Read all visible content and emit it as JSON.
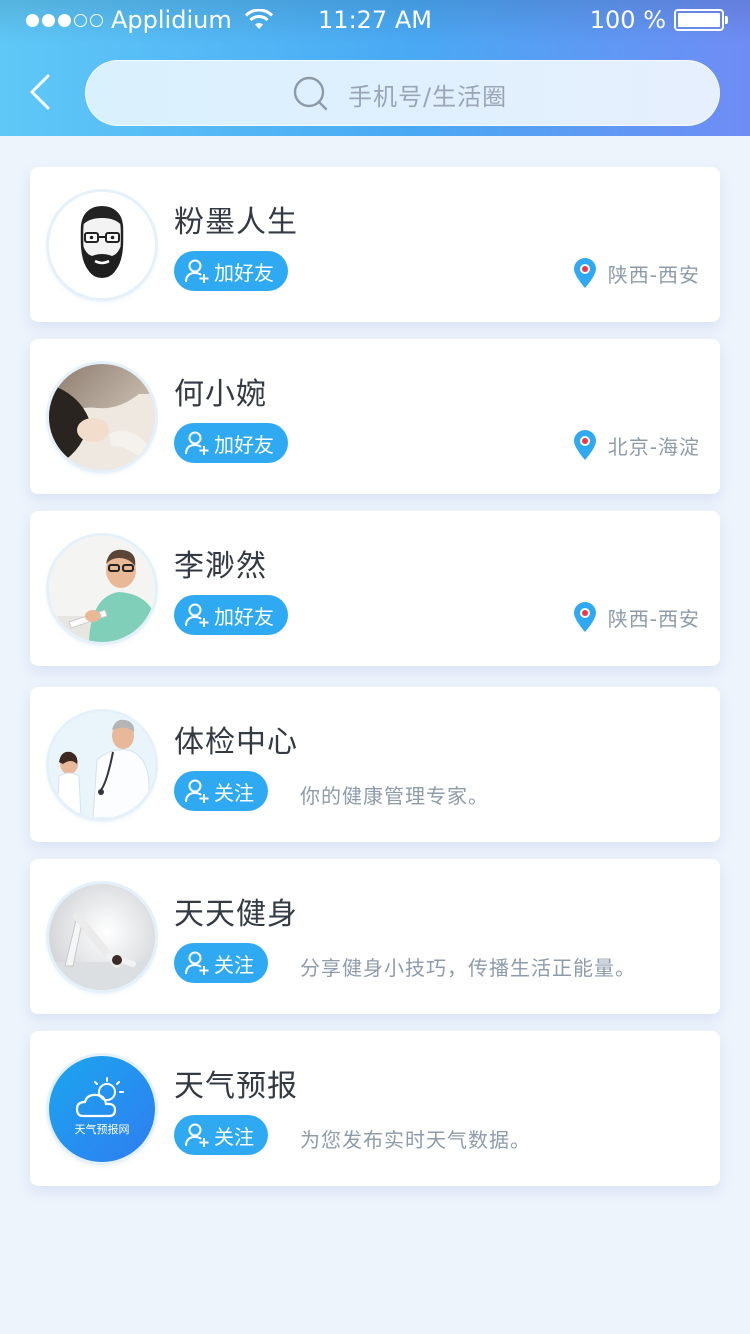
{
  "status_bar": {
    "carrier": "Applidium",
    "time": "11:27 AM",
    "battery": "100 %"
  },
  "search": {
    "placeholder": "手机号/生活圈"
  },
  "colors": {
    "accent": "#2fa9f2",
    "header_start": "#5fc8f7",
    "header_end": "#6f8cf5",
    "pin": "#2fa9f2",
    "pin_dot": "#f0364a"
  },
  "items": [
    {
      "name": "粉墨人生",
      "button": "加好友",
      "location": "陕西-西安",
      "avatar_icon": "bearded-man-avatar-icon"
    },
    {
      "name": "何小婉",
      "button": "加好友",
      "location": "北京-海淀",
      "avatar_icon": "woman-photo-avatar"
    },
    {
      "name": "李渺然",
      "button": "加好友",
      "location": "陕西-西安",
      "avatar_icon": "man-glasses-photo-avatar"
    },
    {
      "name": "体检中心",
      "button": "关注",
      "desc": "你的健康管理专家。",
      "avatar_icon": "doctor-photo-avatar"
    },
    {
      "name": "天天健身",
      "button": "关注",
      "desc": "分享健身小技巧，传播生活正能量。",
      "avatar_icon": "yoga-photo-avatar"
    },
    {
      "name": "天气预报",
      "button": "关注",
      "desc": "为您发布实时天气数据。",
      "avatar_icon": "weather-logo-avatar",
      "logo_text": "天气预报网"
    }
  ]
}
